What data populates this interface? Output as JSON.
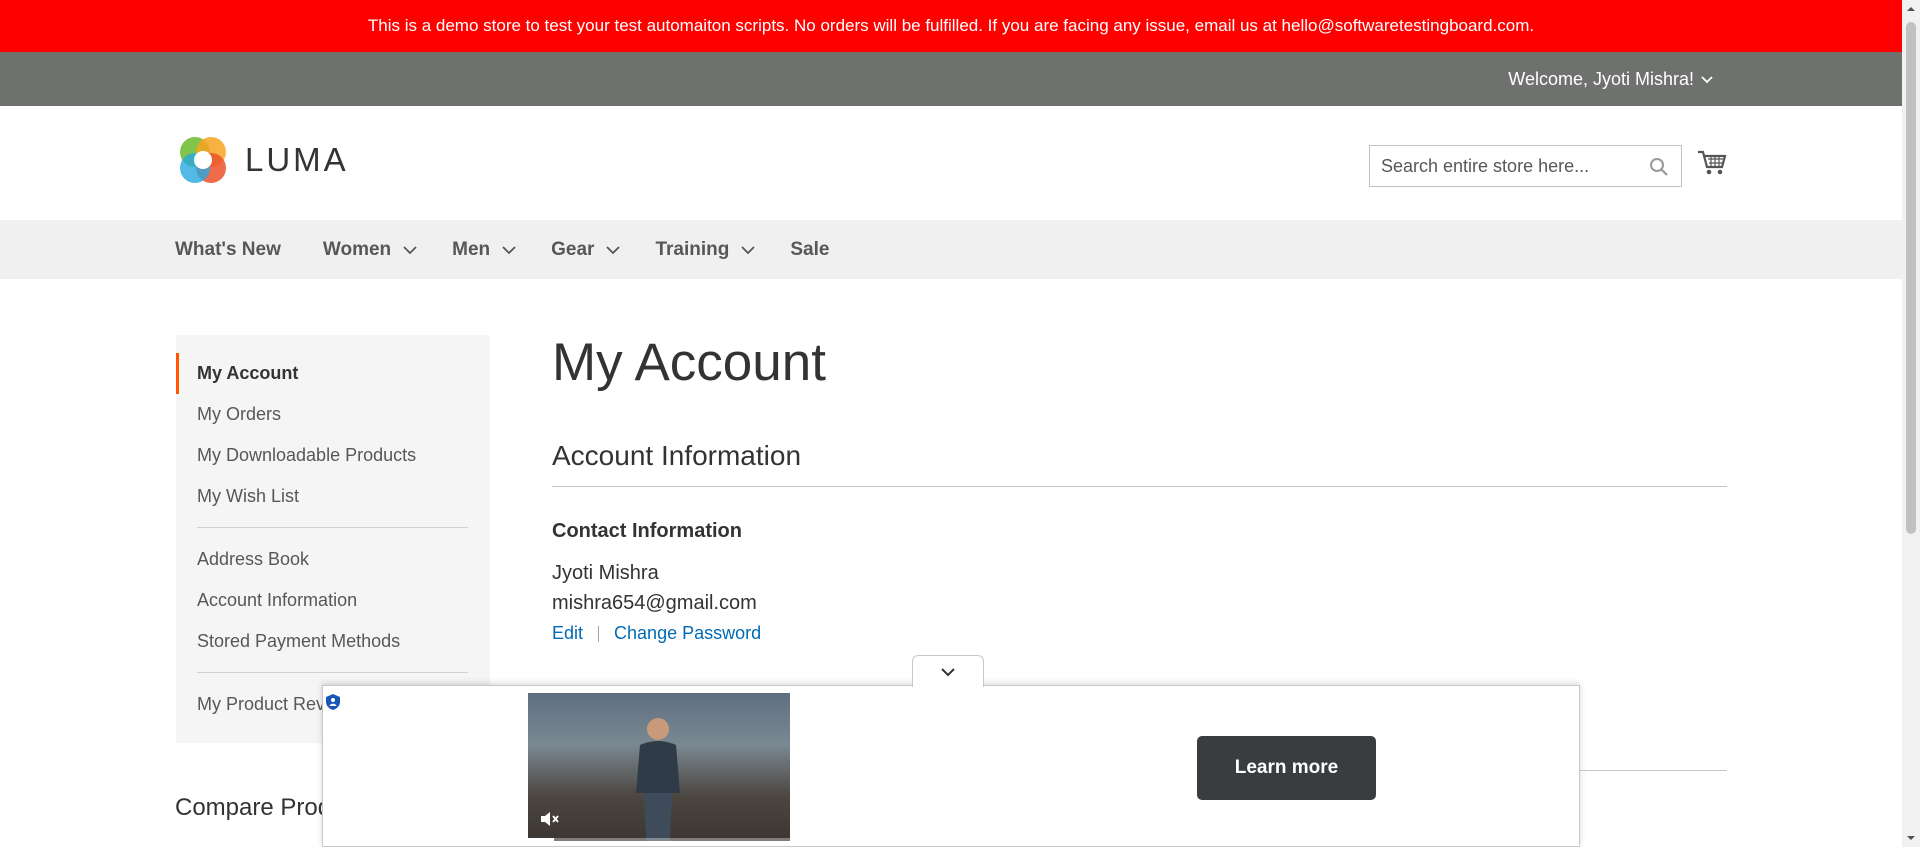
{
  "demo_banner": {
    "text": "This is a demo store to test your test automaiton scripts. No orders will be fulfilled. If you are facing any issue, email us at hello@softwaretestingboard.com."
  },
  "topbar": {
    "welcome": "Welcome, Jyoti Mishra!"
  },
  "header": {
    "logo_text": "LUMA",
    "search_placeholder": "Search entire store here..."
  },
  "nav": {
    "items": [
      {
        "label": "What's New"
      },
      {
        "label": "Women"
      },
      {
        "label": "Men"
      },
      {
        "label": "Gear"
      },
      {
        "label": "Training"
      },
      {
        "label": "Sale"
      }
    ]
  },
  "sidebar": {
    "items": [
      {
        "label": "My Account"
      },
      {
        "label": "My Orders"
      },
      {
        "label": "My Downloadable Products"
      },
      {
        "label": "My Wish List"
      },
      {
        "label": "Address Book"
      },
      {
        "label": "Account Information"
      },
      {
        "label": "Stored Payment Methods"
      },
      {
        "label": "My Product Rev"
      }
    ],
    "compare_title": "Compare Prod"
  },
  "main": {
    "page_title": "My Account",
    "section_title": "Account Information",
    "contact": {
      "title": "Contact Information",
      "name": "Jyoti Mishra",
      "email": "mishra654@gmail.com",
      "edit_label": "Edit",
      "change_password_label": "Change Password"
    }
  },
  "ad": {
    "button_label": "Learn more",
    "progress": 0.1
  },
  "colors": {
    "banner": "#ff0000",
    "topbar": "#6e716e",
    "accent": "#ff5501",
    "link": "#006bb4"
  }
}
